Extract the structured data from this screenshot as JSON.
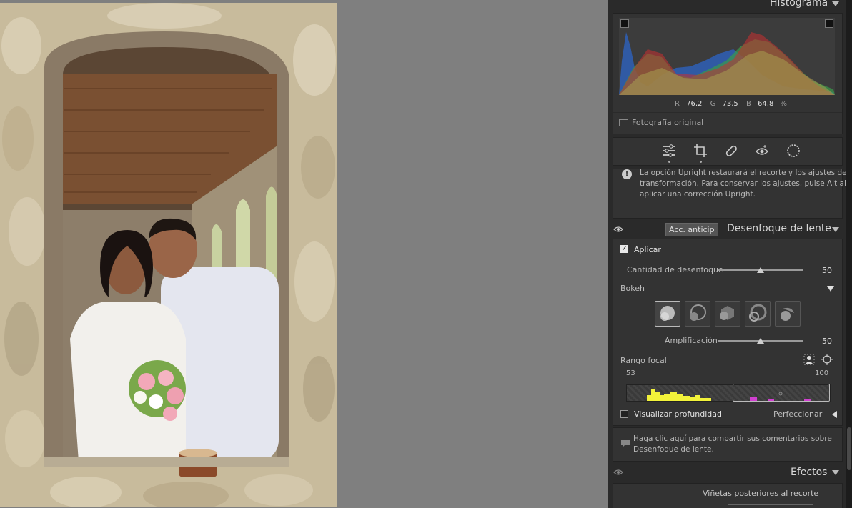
{
  "histogram": {
    "title": "Histograma",
    "r_label": "R",
    "r_value": "76,2",
    "g_label": "G",
    "g_value": "73,5",
    "b_label": "B",
    "b_value": "64,8",
    "percent": "%",
    "original_label": "Fotografía original"
  },
  "tools": [
    "sliders-icon",
    "crop-icon",
    "healing-icon",
    "redeye-icon",
    "mask-icon"
  ],
  "upright_notice": {
    "line1": "La opción Upright restaurará el recorte y los ajustes de",
    "line2": "transformación. Para conservar los ajustes, pulse Alt al",
    "line3": "aplicar una corrección Upright."
  },
  "lens_blur": {
    "early_access": "Acc. anticip",
    "title": "Desenfoque de lente",
    "apply_label": "Aplicar",
    "blur_amount_label": "Cantidad de desenfoque",
    "blur_amount_value": "50",
    "blur_amount": 0.5,
    "bokeh_label": "Bokeh",
    "boost_label": "Amplificación",
    "boost_value": "50",
    "boost_amount": 0.5,
    "focal_range_label": "Rango focal",
    "focal_min": "53",
    "focal_max": "100",
    "visualize_depth_label": "Visualizar profundidad",
    "refine_label": "Perfeccionar"
  },
  "feedback": {
    "line1": "Haga clic aquí para compartir sus comentarios sobre",
    "line2": "Desenfoque de lente."
  },
  "effects": {
    "title": "Efectos",
    "vignette_label": "Viñetas posteriores al recorte"
  },
  "colors": {
    "panel_bg": "#2a2a2a",
    "section_bg": "#333333",
    "accent_yellow": "#f2f23a",
    "accent_magenta": "#d040d0"
  }
}
